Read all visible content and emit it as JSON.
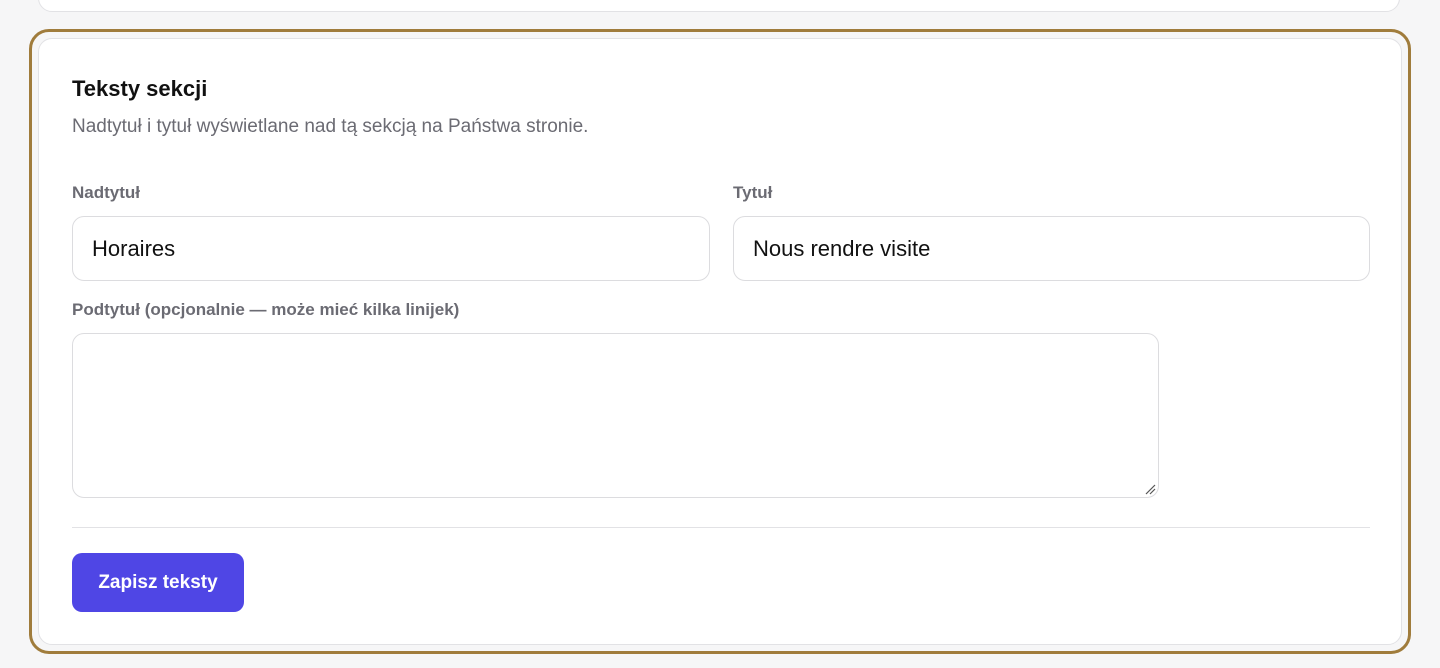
{
  "section": {
    "title": "Teksty sekcji",
    "description": "Nadtytuł i tytuł wyświetlane nad tą sekcją na Państwa stronie."
  },
  "fields": {
    "overtitle": {
      "label": "Nadtytuł",
      "value": "Horaires"
    },
    "title": {
      "label": "Tytuł",
      "value": "Nous rendre visite"
    },
    "subtitle": {
      "label": "Podtytuł (opcjonalnie — może mieć kilka linijek)",
      "value": ""
    }
  },
  "actions": {
    "save_label": "Zapisz teksty"
  },
  "colors": {
    "accent": "#4f46e5",
    "highlight_border": "#a07c3c",
    "muted_text": "#6b6b73"
  }
}
